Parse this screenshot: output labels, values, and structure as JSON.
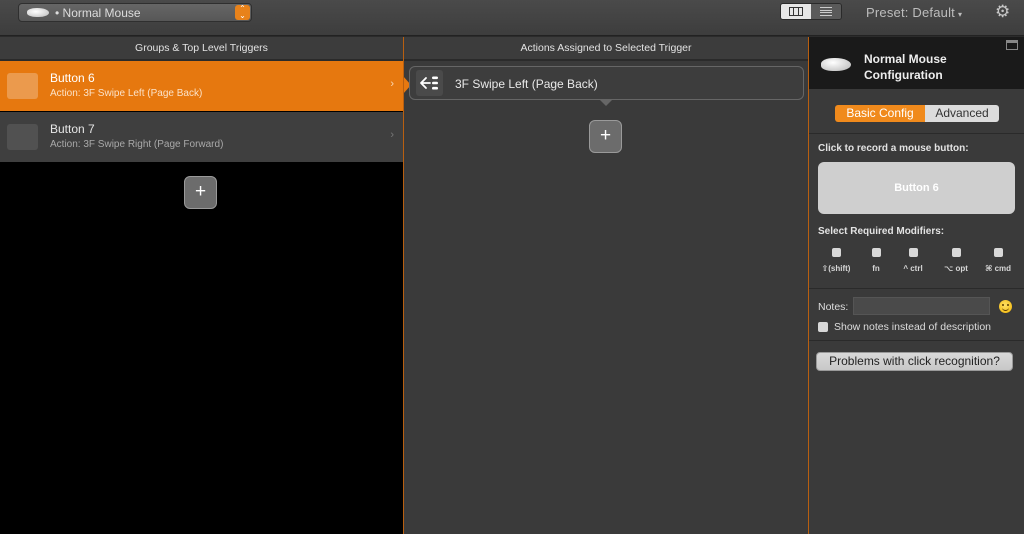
{
  "toolbar": {
    "device_label": "Normal Mouse",
    "preset_label": "Preset: Default",
    "stepper_glyph": "⌃⌄",
    "caret_glyph": "▾",
    "gear_glyph": "⚙"
  },
  "headers": {
    "left": "Groups & Top Level Triggers",
    "middle": "Actions Assigned to Selected Trigger"
  },
  "triggers": [
    {
      "title": "Button 6",
      "subtitle": "Action: 3F Swipe Left (Page Back)",
      "selected": true
    },
    {
      "title": "Button 7",
      "subtitle": "Action: 3F Swipe Right (Page Forward)",
      "selected": false
    }
  ],
  "chevron_glyph": "›",
  "add_glyph": "+",
  "actions": [
    {
      "label": "3F Swipe Left (Page Back)",
      "icon": "swipe-left-icon"
    }
  ],
  "panel": {
    "title": "Normal Mouse Configuration",
    "tabs": {
      "basic": "Basic Config",
      "advanced": "Advanced"
    },
    "record_label": "Click to record a mouse button:",
    "record_value": "Button 6",
    "modifiers_label": "Select Required Modifiers:",
    "modifiers": [
      "⇧(shift)",
      "fn",
      "^ ctrl",
      "⌥ opt",
      "⌘ cmd"
    ],
    "notes_label": "Notes:",
    "notes_value": "",
    "show_notes_label": "Show notes instead of description",
    "problems_button": "Problems with click recognition?"
  },
  "colors": {
    "accent": "#e6780f",
    "tab_active": "#f08a1c"
  }
}
